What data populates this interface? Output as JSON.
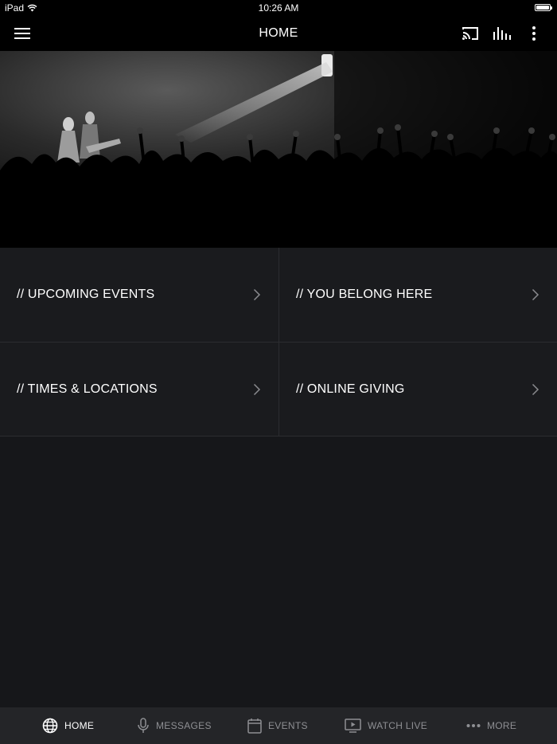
{
  "status_bar": {
    "device": "iPad",
    "time": "10:26 AM"
  },
  "nav": {
    "title": "HOME"
  },
  "tiles": [
    {
      "label": "// UPCOMING EVENTS"
    },
    {
      "label": "// YOU BELONG HERE"
    },
    {
      "label": "// TIMES & LOCATIONS"
    },
    {
      "label": "// ONLINE GIVING"
    }
  ],
  "tab_bar": {
    "tabs": [
      {
        "label": "HOME",
        "icon": "globe-icon",
        "active": true
      },
      {
        "label": "MESSAGES",
        "icon": "microphone-icon",
        "active": false
      },
      {
        "label": "EVENTS",
        "icon": "calendar-icon",
        "active": false
      },
      {
        "label": "WATCH LIVE",
        "icon": "play-screen-icon",
        "active": false
      },
      {
        "label": "MORE",
        "icon": "more-dots-icon",
        "active": false
      }
    ]
  },
  "colors": {
    "background": "#16171a",
    "bar": "#000000",
    "tile": "#1a1b1e",
    "tab_bar": "#242528",
    "inactive_tab": "#8e8f93"
  }
}
